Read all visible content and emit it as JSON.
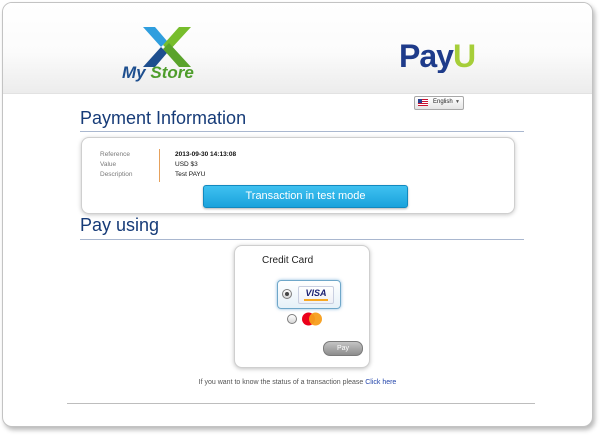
{
  "header": {
    "store_name_part1": "My",
    "store_name_part2": "Store",
    "payu_logo_text": "PayU"
  },
  "language": {
    "selected": "English",
    "flag_icon": "us-flag-icon"
  },
  "payment_info": {
    "title": "Payment Information",
    "rows": [
      {
        "label": "Reference",
        "value": "2013-09-30 14:13:08"
      },
      {
        "label": "Value",
        "value": "USD $3"
      },
      {
        "label": "Description",
        "value": "Test PAYU"
      }
    ],
    "test_mode_badge": "Transaction in test mode"
  },
  "pay_using": {
    "title": "Pay using",
    "card_title": "Credit Card",
    "options": [
      {
        "name": "VISA",
        "selected": true
      },
      {
        "name": "MasterCard",
        "selected": false
      }
    ],
    "pay_button": "Pay"
  },
  "status_note": {
    "text": "If you want to know the status of a transaction please ",
    "link": "Click here"
  },
  "colors": {
    "heading": "#163b78",
    "badge": "#1aa2dc",
    "payu_green": "#a6ce39",
    "payu_blue": "#1e3b8a",
    "link": "#2244aa"
  }
}
